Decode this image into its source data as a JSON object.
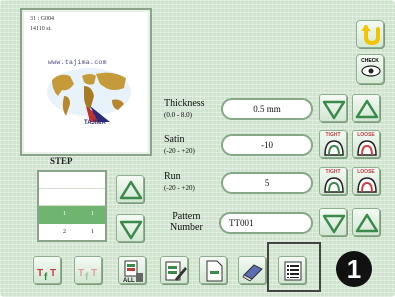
{
  "preview": {
    "design_id": "31 : G004",
    "stitch_count": "14110 st.",
    "url": "www.tajima.com",
    "brand": "TAJIMA"
  },
  "side": {
    "check_label": "CHECK"
  },
  "params": [
    {
      "label": "Thickness",
      "range": "(0.0 - 8.0)",
      "value": "0.5 mm"
    },
    {
      "label": "Satin",
      "range": "(-20 - +20)",
      "value": "-10",
      "tight": "TIGHT",
      "loose": "LOOSE"
    },
    {
      "label": "Run",
      "range": "(-20 - +20)",
      "value": "5",
      "tight": "TIGHT",
      "loose": "LOOSE"
    }
  ],
  "pattern": {
    "label_line1": "Pattern",
    "label_line2": "Number",
    "value": "TT001"
  },
  "step": {
    "title": "STEP",
    "rows": [
      {
        "a": "",
        "b": ""
      },
      {
        "a": "",
        "b": ""
      },
      {
        "a": "1",
        "b": "1"
      },
      {
        "a": "2",
        "b": "1"
      }
    ]
  },
  "toolbar": {
    "all_label": "ALL"
  },
  "callout": {
    "number": "1"
  },
  "colors": {
    "panel_bg": "#cfe3cf",
    "accent_green": "#2e8b3a",
    "arrow_green": "#3a8a4a",
    "step_highlight": "#6fb46f"
  }
}
